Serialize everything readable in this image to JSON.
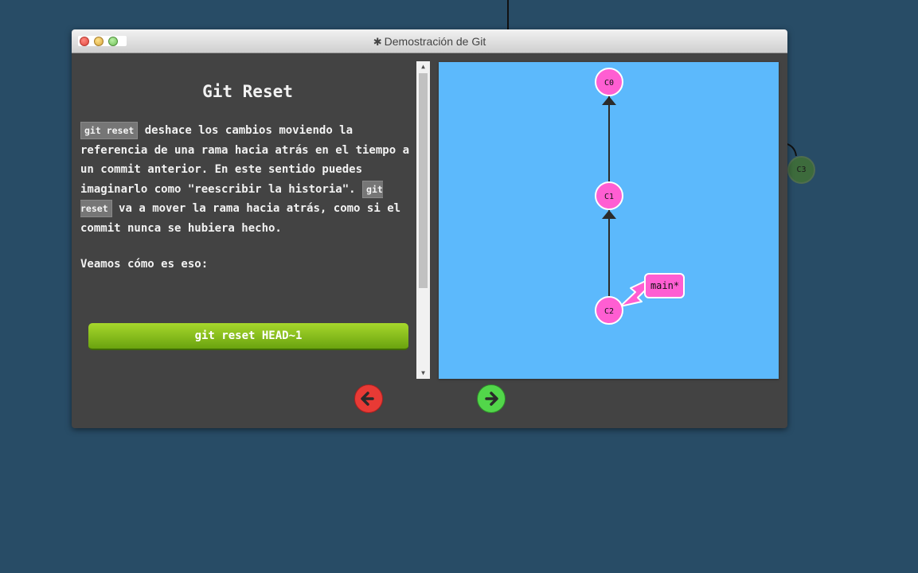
{
  "window": {
    "title": "Demostración de Git",
    "title_icon": "gear-icon"
  },
  "lesson": {
    "heading": "Git Reset",
    "para_code_1": "git reset",
    "para_text_1": " deshace los cambios moviendo la referencia de una rama hacia atrás en el tiempo a un commit anterior. En este sentido puedes imaginarlo como \"reescribir la historia\". ",
    "para_code_2": "git reset",
    "para_text_2": " va a mover la rama hacia atrás, como si el commit nunca se hubiera hecho.",
    "para2": "Veamos cómo es eso:",
    "command_button": "git reset HEAD~1"
  },
  "graph": {
    "commits": [
      "C0",
      "C1",
      "C2"
    ],
    "branch_label": "main*",
    "background_commit": "C3"
  },
  "nav": {
    "back_icon": "arrow-left-icon",
    "next_icon": "arrow-right-icon"
  },
  "colors": {
    "background": "#284c66",
    "canvas": "#5cb9fc",
    "commit_node": "#ff5ed2",
    "branch_tag": "#ff5ed2",
    "button_green": "#8bc81e",
    "back_red": "#e83a35",
    "next_green": "#52d64a"
  }
}
